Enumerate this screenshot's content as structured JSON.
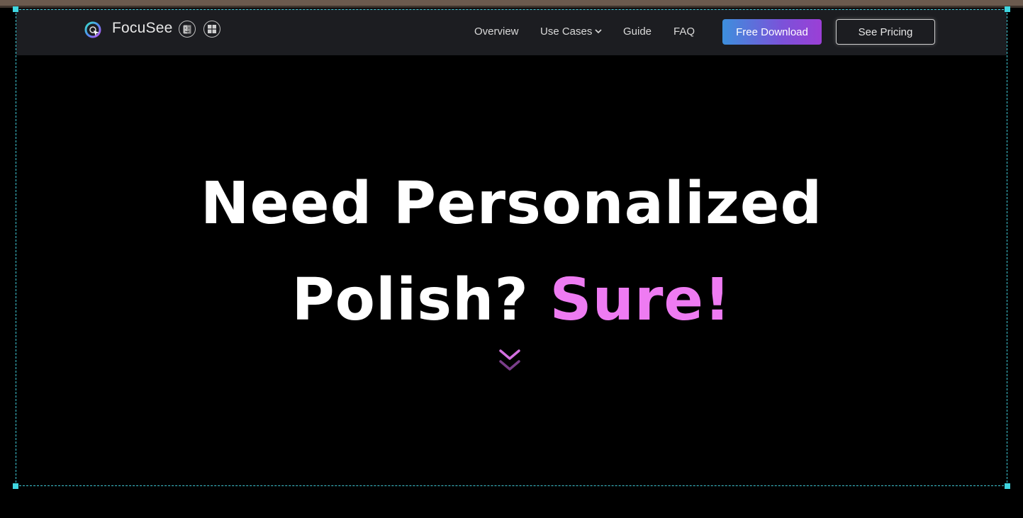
{
  "brand": {
    "name": "FocuSee",
    "platforms": [
      "mac-finder-icon",
      "windows-icon"
    ]
  },
  "nav": {
    "links": [
      {
        "label": "Overview"
      },
      {
        "label": "Use Cases",
        "has_dropdown": true
      },
      {
        "label": "Guide"
      },
      {
        "label": "FAQ"
      }
    ],
    "download_label": "Free Download",
    "pricing_label": "See Pricing"
  },
  "hero": {
    "line1": "Need Personalized",
    "line2_plain": "Polish? ",
    "line2_accent": "Sure!"
  },
  "colors": {
    "accent": "#ee7bf2",
    "download_gradient_start": "#3d8fdc",
    "download_gradient_end": "#9b3fd6",
    "selection_frame": "#3fc7d4"
  }
}
